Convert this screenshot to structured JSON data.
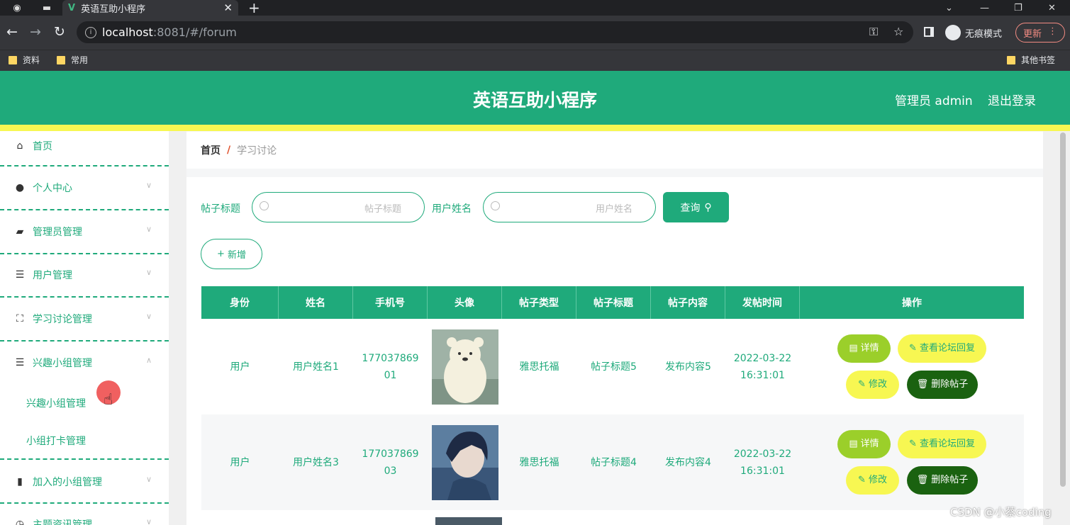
{
  "browser": {
    "tab_title": "英语互助小程序",
    "tab_close": "✕",
    "new_tab": "+",
    "url_host": "localhost",
    "url_path": ":8081/#/forum",
    "incognito_label": "无痕模式",
    "update_label": "更新",
    "bookmarks": [
      "资料",
      "常用"
    ],
    "other_bookmarks": "其他书签"
  },
  "header": {
    "title": "英语互助小程序",
    "admin": "管理员 admin",
    "logout": "退出登录"
  },
  "sidebar": {
    "items": [
      {
        "label": "首页",
        "icon": "home-icon"
      },
      {
        "label": "个人中心",
        "icon": "user-icon"
      },
      {
        "label": "管理员管理",
        "icon": "ticket-icon"
      },
      {
        "label": "用户管理",
        "icon": "list-icon"
      },
      {
        "label": "学习讨论管理",
        "icon": "frame-icon"
      },
      {
        "label": "兴趣小组管理",
        "icon": "list-icon"
      },
      {
        "label": "加入的小组管理",
        "icon": "chart-icon"
      },
      {
        "label": "主题资讯管理",
        "icon": "clock-icon"
      }
    ],
    "sub_items": [
      "兴趣小组管理",
      "小组打卡管理"
    ]
  },
  "breadcrumb": {
    "home": "首页",
    "separator": "/",
    "current": "学习讨论"
  },
  "search": {
    "title_label": "帖子标题",
    "title_placeholder": "帖子标题",
    "name_label": "用户姓名",
    "name_placeholder": "用户姓名",
    "query_button": "查询",
    "add_button": "新增"
  },
  "table": {
    "columns": [
      "身份",
      "姓名",
      "手机号",
      "头像",
      "帖子类型",
      "帖子标题",
      "帖子内容",
      "发帖时间",
      "操作"
    ],
    "rows": [
      {
        "identity": "用户",
        "name": "用户姓名1",
        "phone_l1": "177037869",
        "phone_l2": "01",
        "avatar": "white-bear-avatar",
        "type": "雅思托福",
        "title": "帖子标题5",
        "content": "发布内容5",
        "date": "2022-03-22",
        "time": "16:31:01"
      },
      {
        "identity": "用户",
        "name": "用户姓名3",
        "phone_l1": "177037869",
        "phone_l2": "03",
        "avatar": "anime-boy-avatar",
        "type": "雅思托福",
        "title": "帖子标题4",
        "content": "发布内容4",
        "date": "2022-03-22",
        "time": "16:31:01"
      }
    ],
    "actions": {
      "detail": "详情",
      "reply": "查看论坛回复",
      "edit": "修改",
      "delete": "删除帖子"
    }
  },
  "watermark": "CSDN @小蔡coding",
  "colors": {
    "primary": "#1faa7b",
    "yellow": "#f7f752",
    "detail_green": "#9bcf2a",
    "delete_dark": "#1a6210"
  }
}
